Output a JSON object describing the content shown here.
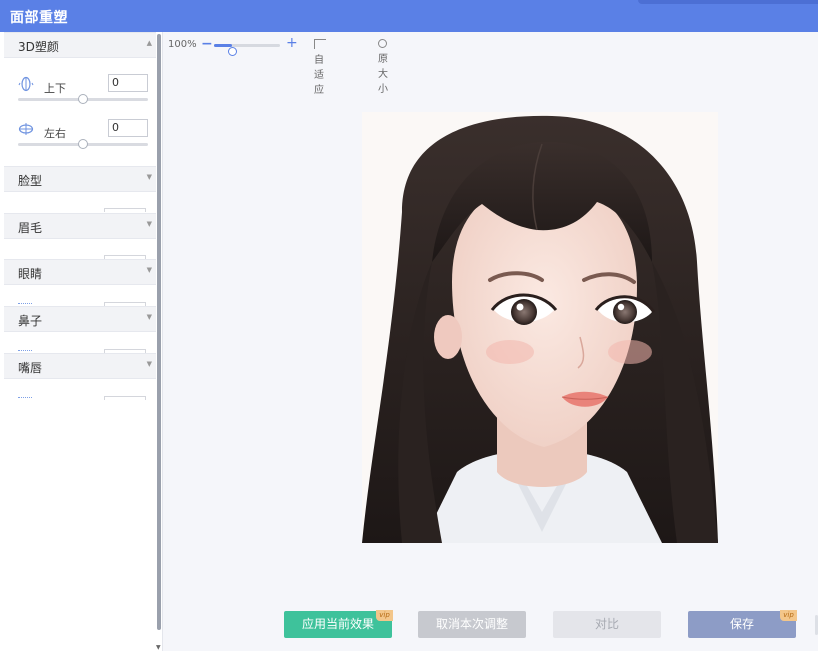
{
  "window": {
    "title": "面部重塑"
  },
  "panel": {
    "sections": [
      {
        "label": "3D塑颜",
        "expanded": true,
        "controls": [
          {
            "label": "上下",
            "value": "0",
            "slider": 0.5,
            "icon": "vertical-rotate-icon"
          },
          {
            "label": "左右",
            "value": "0",
            "slider": 0.5,
            "icon": "horizontal-rotate-icon"
          }
        ]
      },
      {
        "label": "脸型",
        "expanded": false
      },
      {
        "label": "眉毛",
        "expanded": false
      },
      {
        "label": "眼睛",
        "expanded": false
      },
      {
        "label": "鼻子",
        "expanded": false
      },
      {
        "label": "嘴唇",
        "expanded": false
      }
    ]
  },
  "toolbar": {
    "zoom_label": "100%",
    "zoom_level": 0.28,
    "fit_label": "自适应",
    "original_label": "原大小"
  },
  "buttons": {
    "apply": "应用当前效果",
    "cancel": "取消本次调整",
    "compare": "对比",
    "save": "保存",
    "vip": "vip"
  },
  "colors": {
    "title_bar": "#5a80e6",
    "apply": "#3ec29b",
    "save": "#8d9cc6",
    "accent": "#5a80e6"
  }
}
